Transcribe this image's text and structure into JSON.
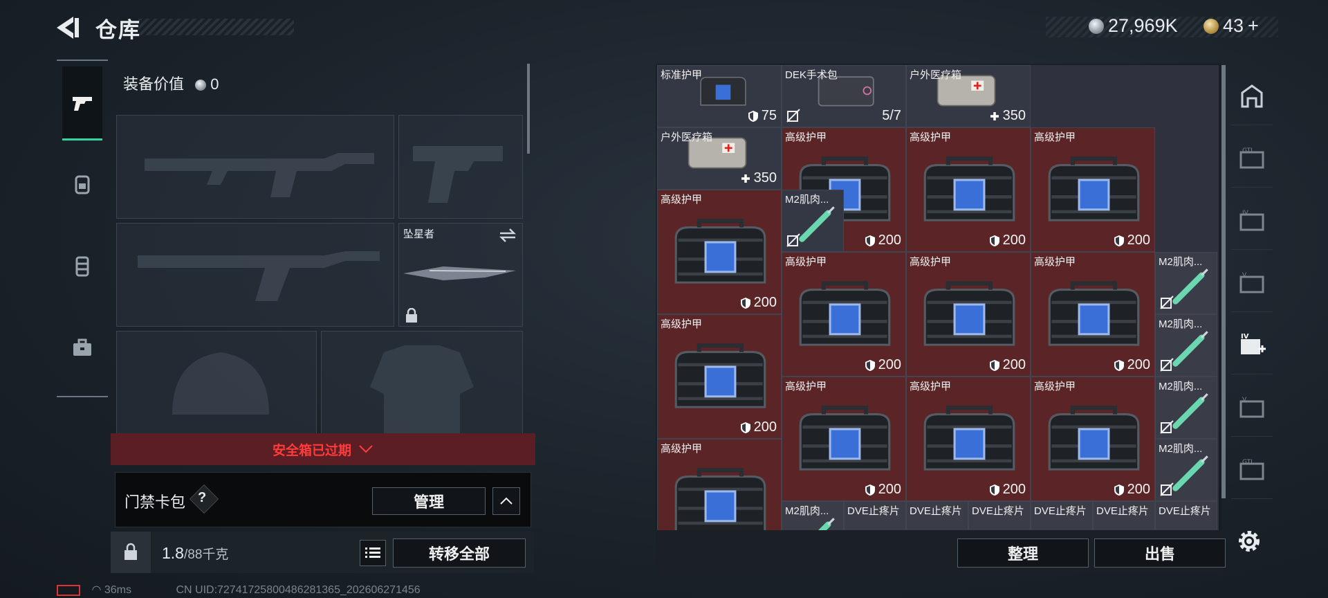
{
  "header": {
    "title": "仓库"
  },
  "currency": {
    "silver": "27,969K",
    "gold": "43"
  },
  "equipment": {
    "value_label": "装备价值",
    "value": "0",
    "melee_name": "坠星者"
  },
  "safe_box": {
    "expired_text": "安全箱已过期"
  },
  "card_pack": {
    "label": "门禁卡包",
    "help": "?",
    "manage_label": "管理"
  },
  "storage": {
    "weight": "1.8",
    "capacity": "/88千克",
    "transfer_all_label": "转移全部"
  },
  "status": {
    "ping": "36ms",
    "uid": "CN UID:7274172580048628136​5_202606271456"
  },
  "inventory": {
    "sort_label": "整理",
    "sell_label": "出售",
    "items": [
      {
        "name": "标准护甲",
        "value": "75",
        "kind": "armor-std"
      },
      {
        "name": "DEK手术包",
        "value": "5/7",
        "kind": "surgery"
      },
      {
        "name": "户外医疗箱",
        "value": "350",
        "kind": "medkit"
      },
      {
        "name": "户外医疗箱",
        "value": "350",
        "kind": "medkit"
      },
      {
        "name": "高级护甲",
        "value": "200",
        "kind": "armor"
      },
      {
        "name": "高级护甲",
        "value": "200",
        "kind": "armor"
      },
      {
        "name": "高级护甲",
        "value": "200",
        "kind": "armor"
      },
      {
        "name": "高级护甲",
        "value": "200",
        "kind": "armor"
      },
      {
        "name": "M2肌肉...",
        "value": "",
        "kind": "syringe"
      },
      {
        "name": "高级护甲",
        "value": "200",
        "kind": "armor"
      },
      {
        "name": "高级护甲",
        "value": "200",
        "kind": "armor"
      },
      {
        "name": "高级护甲",
        "value": "200",
        "kind": "armor"
      },
      {
        "name": "M2肌肉...",
        "value": "",
        "kind": "syringe"
      },
      {
        "name": "高级护甲",
        "value": "200",
        "kind": "armor"
      },
      {
        "name": "M2肌肉...",
        "value": "",
        "kind": "syringe"
      },
      {
        "name": "高级护甲",
        "value": "200",
        "kind": "armor"
      },
      {
        "name": "高级护甲",
        "value": "200",
        "kind": "armor"
      },
      {
        "name": "高级护甲",
        "value": "200",
        "kind": "armor"
      },
      {
        "name": "M2肌肉...",
        "value": "",
        "kind": "syringe"
      },
      {
        "name": "高级护甲",
        "value": "",
        "kind": "armor"
      },
      {
        "name": "M2肌肉...",
        "value": "",
        "kind": "syringe"
      },
      {
        "name": "M2肌肉...",
        "value": "",
        "kind": "syringe"
      },
      {
        "name": "DVE止疼片",
        "value": "",
        "kind": "pill"
      },
      {
        "name": "DVE止疼片",
        "value": "",
        "kind": "pill"
      },
      {
        "name": "DVE止疼片",
        "value": "",
        "kind": "pill"
      },
      {
        "name": "DVE止疼片",
        "value": "",
        "kind": "pill"
      },
      {
        "name": "DVE止疼片",
        "value": "",
        "kind": "pill"
      },
      {
        "name": "DVE止疼片",
        "value": "",
        "kind": "pill"
      }
    ]
  },
  "colors": {
    "accent": "#35d4a1",
    "expired": "#ff3b3b",
    "item_red": "#5b2527",
    "item_normal": "#343744"
  }
}
